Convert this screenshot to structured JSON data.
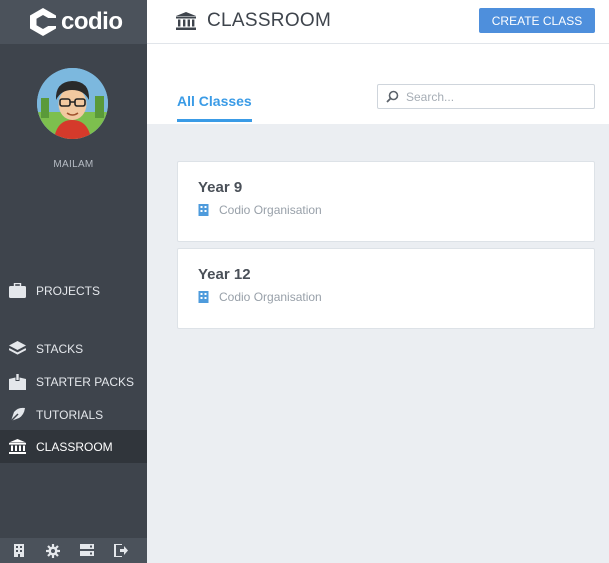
{
  "brand": {
    "name": "codio"
  },
  "user": {
    "name": "MAILAM"
  },
  "sidebar": {
    "items": [
      {
        "label": "PROJECTS",
        "icon": "briefcase-icon"
      },
      {
        "label": "STACKS",
        "icon": "layers-icon"
      },
      {
        "label": "STARTER PACKS",
        "icon": "box-icon"
      },
      {
        "label": "TUTORIALS",
        "icon": "tutorial-icon"
      },
      {
        "label": "CLASSROOM",
        "icon": "bank-icon",
        "active": true
      }
    ],
    "bottom_icons": [
      "building-icon",
      "gear-icon",
      "server-icon",
      "logout-icon"
    ]
  },
  "header": {
    "title": "CLASSROOM",
    "create_label": "CREATE CLASS"
  },
  "tabs": [
    {
      "label": "All Classes",
      "active": true
    }
  ],
  "search": {
    "placeholder": "Search...",
    "value": ""
  },
  "classes": [
    {
      "name": "Year 9",
      "organisation": "Codio Organisation"
    },
    {
      "name": "Year 12",
      "organisation": "Codio Organisation"
    }
  ],
  "colors": {
    "accent": "#3a9be6",
    "button": "#4e8fdc",
    "sidebar": "#3e444c"
  }
}
